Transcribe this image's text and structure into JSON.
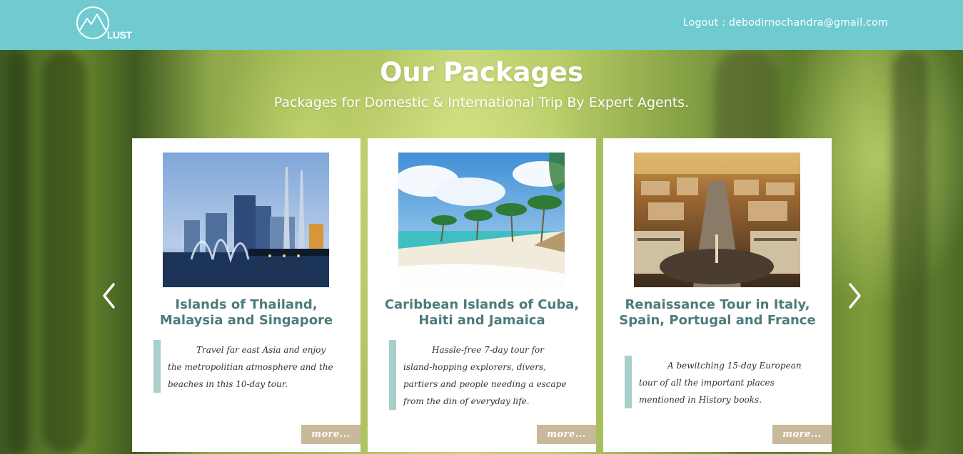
{
  "header": {
    "logo_text": "LUST",
    "logout_label": "Logout :",
    "user_email": "debodirnochandra@gmail.com"
  },
  "main": {
    "title": "Our Packages",
    "subtitle": "Packages for Domestic & International Trip By Expert Agents."
  },
  "carousel": {
    "prev_icon": "chevron-left-icon",
    "next_icon": "chevron-right-icon",
    "packages": [
      {
        "title": "Islands of Thailand, Malaysia and Singapore",
        "description": "Travel far east Asia and enjoy the metropolitian atmosphere and the beaches in this 10-day tour.",
        "more_label": "more..."
      },
      {
        "title": "Caribbean Islands of Cuba, Haiti and Jamaica",
        "description": "Hassle-free 7-day tour for island-hopping explorers, divers, partiers and people needing a escape from the din of everyday life.",
        "more_label": "more..."
      },
      {
        "title": "Renaissance Tour in Italy, Spain, Portugal and France",
        "description": "A bewitching 15-day European tour of all the important places mentioned in History books.",
        "more_label": "more..."
      }
    ]
  },
  "colors": {
    "topbar": "#6fcbd0",
    "card_title": "#4e7b7b",
    "quote_bar": "#a8cfc9",
    "more_button": "#c9b99b"
  }
}
